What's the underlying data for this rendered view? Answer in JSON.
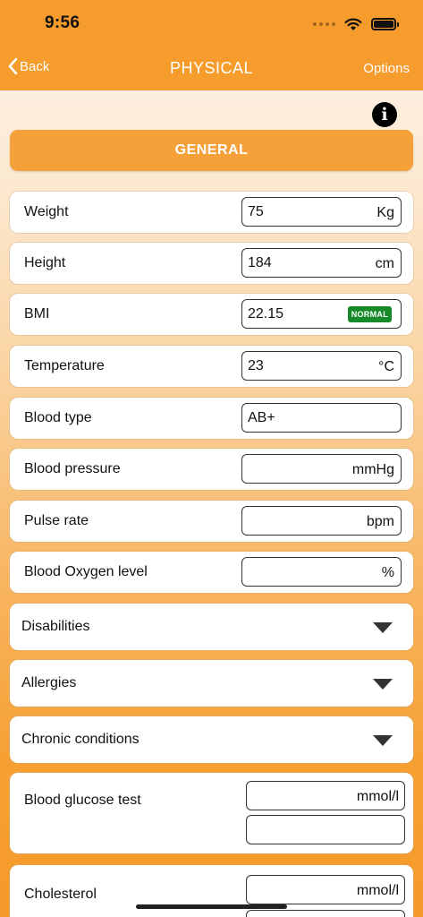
{
  "status": {
    "time": "9:56"
  },
  "nav": {
    "back_label": "Back",
    "title": "PHYSICAL",
    "options_label": "Options"
  },
  "info_icon": "i",
  "section": {
    "label": "GENERAL"
  },
  "fields": [
    {
      "label": "Weight",
      "value": "75",
      "unit": "Kg"
    },
    {
      "label": "Height",
      "value": "184",
      "unit": "cm"
    },
    {
      "label": "BMI",
      "value": "22.15",
      "badge": "NORMAL",
      "badge_color": "#168a29"
    },
    {
      "label": "Temperature",
      "value": "23",
      "unit": "°C"
    },
    {
      "label": "Blood type",
      "value": "AB+"
    },
    {
      "label": "Blood pressure",
      "value": "",
      "unit": "mmHg"
    },
    {
      "label": "Pulse rate",
      "value": "",
      "unit": "bpm"
    },
    {
      "label": "Blood Oxygen level",
      "value": "",
      "unit": "%"
    }
  ],
  "dropdowns": [
    {
      "label": "Disabilities"
    },
    {
      "label": "Allergies"
    },
    {
      "label": "Chronic conditions"
    }
  ],
  "tests": [
    {
      "label": "Blood glucose test",
      "unit": "mmol/l"
    },
    {
      "label": "Cholesterol",
      "unit": "mmol/l"
    }
  ],
  "colors": {
    "accent": "#f69c2c",
    "badge_normal": "#168a29"
  }
}
